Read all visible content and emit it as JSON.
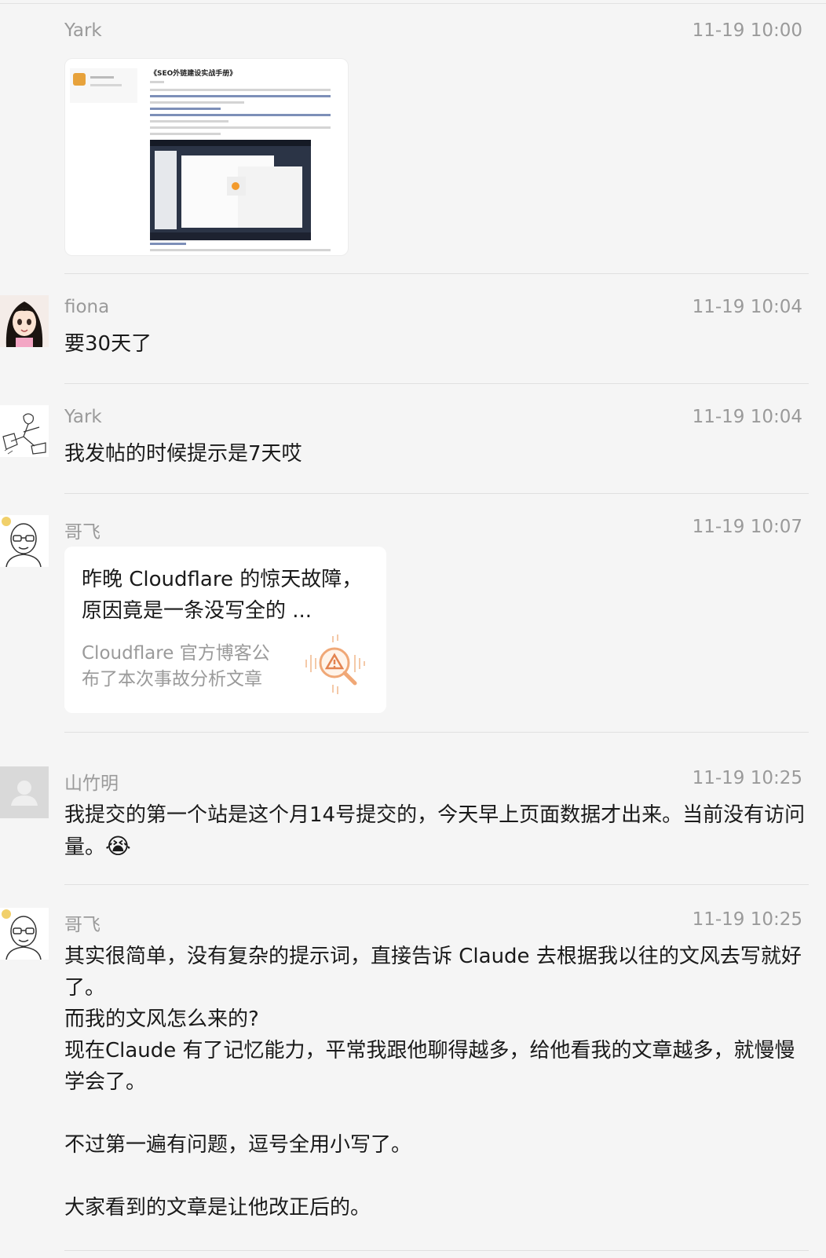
{
  "messages": [
    {
      "sender": "Yark",
      "time": "11-19 10:00",
      "type": "image",
      "image": {
        "title": "《SEO外链建设实战手册》",
        "description": "screenshot of an article about SEO external link building"
      }
    },
    {
      "sender": "fiona",
      "time": "11-19 10:04",
      "type": "text",
      "text": "要30天了"
    },
    {
      "sender": "Yark",
      "time": "11-19 10:04",
      "type": "text",
      "text": "我发帖的时候提示是7天哎"
    },
    {
      "sender": "哥飞",
      "time": "11-19 10:07",
      "type": "link",
      "link": {
        "title": "昨晚 Cloudflare 的惊天故障，原因竟是一条没写全的 ...",
        "description": "Cloudflare 官方博客公布了本次事故分析文章"
      }
    },
    {
      "sender": "山竹明",
      "time": "11-19 10:25",
      "type": "text",
      "text": "我提交的第一个站是这个月14号提交的，今天早上页面数据才出来。当前没有访问量。",
      "emoji": "😭"
    },
    {
      "sender": "哥飞",
      "time": "11-19 10:25",
      "type": "text",
      "text": "其实很简单，没有复杂的提示词，直接告诉 Claude 去根据我以往的文风去写就好了。\n而我的文风怎么来的?\n现在Claude 有了记忆能力，平常我跟他聊得越多，给他看我的文章越多，就慢慢学会了。\n\n不过第一遍有问题，逗号全用小写了。\n\n大家看到的文章是让他改正后的。"
    }
  ],
  "icons": {
    "avatar_fiona": "anime-girl-avatar",
    "avatar_yark": "sketch-drawing-avatar",
    "avatar_gefei": "glasses-man-avatar",
    "avatar_shanzhuming": "default-person-avatar",
    "link_thumb": "warning-magnifier-icon"
  },
  "colors": {
    "background": "#f5f5f5",
    "card": "#ffffff",
    "secondary_text": "#9a9a9a",
    "primary_text": "#1a1a1a",
    "divider": "#e0e0e0"
  }
}
